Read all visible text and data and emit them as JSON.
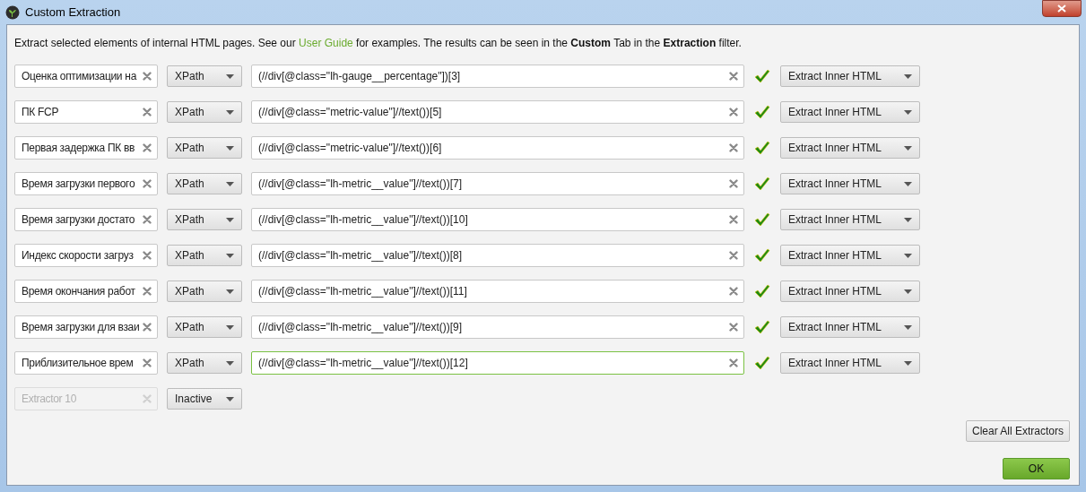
{
  "window": {
    "title": "Custom Extraction"
  },
  "intro": {
    "before": "Extract selected elements of internal HTML pages. See our",
    "link": "User Guide",
    "after": "for examples. The results can be seen in the **Custom** Tab in the **Extraction** filter."
  },
  "extractors": [
    {
      "name": "Оценка оптимизации на",
      "type": "XPath",
      "expression": "(//div[@class=\"lh-gauge__percentage\"])[3]",
      "focused": false,
      "valid": true,
      "mode": "Extract Inner HTML",
      "disabled": false
    },
    {
      "name": "ПК FCP",
      "type": "XPath",
      "expression": "(//div[@class=\"metric-value\"]//text())[5]",
      "focused": false,
      "valid": true,
      "mode": "Extract Inner HTML",
      "disabled": false
    },
    {
      "name": "Первая задержка ПК вв",
      "type": "XPath",
      "expression": "(//div[@class=\"metric-value\"]//text())[6]",
      "focused": false,
      "valid": true,
      "mode": "Extract Inner HTML",
      "disabled": false
    },
    {
      "name": "Время загрузки первого",
      "type": "XPath",
      "expression": "(//div[@class=\"lh-metric__value\"]//text())[7]",
      "focused": false,
      "valid": true,
      "mode": "Extract Inner HTML",
      "disabled": false
    },
    {
      "name": "Время загрузки достато",
      "type": "XPath",
      "expression": "(//div[@class=\"lh-metric__value\"]//text())[10]",
      "focused": false,
      "valid": true,
      "mode": "Extract Inner HTML",
      "disabled": false
    },
    {
      "name": "Индекс скорости загруз",
      "type": "XPath",
      "expression": "(//div[@class=\"lh-metric__value\"]//text())[8]",
      "focused": false,
      "valid": true,
      "mode": "Extract Inner HTML",
      "disabled": false
    },
    {
      "name": "Время окончания работ",
      "type": "XPath",
      "expression": "(//div[@class=\"lh-metric__value\"]//text())[11]",
      "focused": false,
      "valid": true,
      "mode": "Extract Inner HTML",
      "disabled": false
    },
    {
      "name": "Время загрузки для взаи",
      "type": "XPath",
      "expression": "(//div[@class=\"lh-metric__value\"]//text())[9]",
      "focused": false,
      "valid": true,
      "mode": "Extract Inner HTML",
      "disabled": false
    },
    {
      "name": "Приблизительное врем",
      "type": "XPath",
      "expression": "(//div[@class=\"lh-metric__value\"]//text())[12]",
      "focused": true,
      "valid": true,
      "mode": "Extract Inner HTML",
      "disabled": false
    },
    {
      "name": "Extractor 10",
      "type": "Inactive",
      "disabled": true
    }
  ],
  "buttons": {
    "clear": "Clear All Extractors",
    "ok": "OK"
  }
}
